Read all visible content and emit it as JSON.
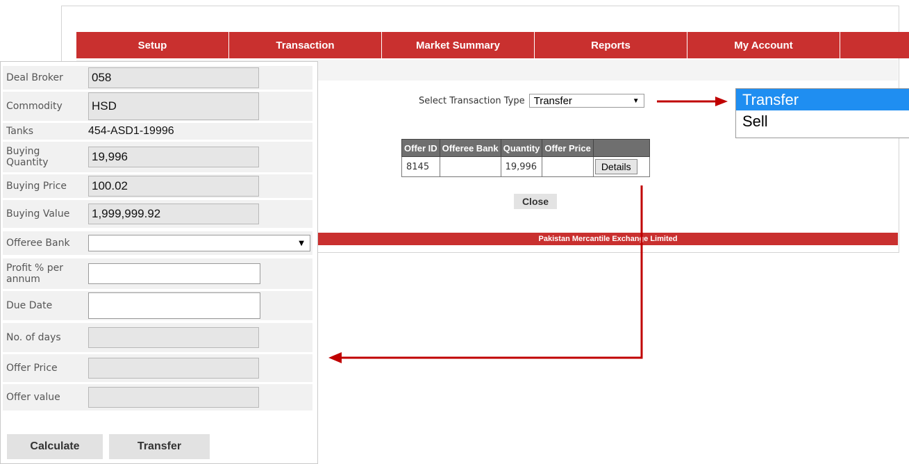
{
  "nav": {
    "items": [
      "Setup",
      "Transaction",
      "Market Summary",
      "Reports",
      "My Account"
    ]
  },
  "transaction_type": {
    "label": "Select Transaction Type",
    "selected": "Transfer",
    "options": [
      "Transfer",
      "Sell"
    ]
  },
  "offers_table": {
    "headers": [
      "Offer ID",
      "Offeree Bank",
      "Quantity",
      "Offer Price"
    ],
    "rows": [
      {
        "offer_id": "8145",
        "offeree_bank": "",
        "quantity": "19,996",
        "offer_price": "",
        "action": "Details"
      }
    ]
  },
  "close_button": "Close",
  "footer": "Pakistan Mercantile Exchange Limited",
  "form": {
    "deal_broker": {
      "label": "Deal Broker",
      "value": "058"
    },
    "commodity": {
      "label": "Commodity",
      "value": "HSD"
    },
    "tanks": {
      "label": "Tanks",
      "value": "454-ASD1-19996"
    },
    "buying_quantity": {
      "label": "Buying Quantity",
      "value": "19,996"
    },
    "buying_price": {
      "label": "Buying Price",
      "value": "100.02"
    },
    "buying_value": {
      "label": "Buying Value",
      "value": "1,999,999.92"
    },
    "offeree_bank": {
      "label": "Offeree Bank",
      "value": ""
    },
    "profit": {
      "label": "Profit % per annum",
      "value": ""
    },
    "due_date": {
      "label": "Due Date",
      "value": ""
    },
    "no_of_days": {
      "label": "No. of days",
      "value": ""
    },
    "offer_price": {
      "label": "Offer Price",
      "value": ""
    },
    "offer_value": {
      "label": "Offer value",
      "value": ""
    },
    "calculate_button": "Calculate",
    "transfer_button": "Transfer"
  },
  "colors": {
    "nav_red": "#c9302f",
    "selected_option": "#1f8ef1",
    "arrow_red": "#c00000"
  },
  "icons": {
    "dropdown": "caret-down-icon",
    "arrow": "arrow-icon"
  }
}
